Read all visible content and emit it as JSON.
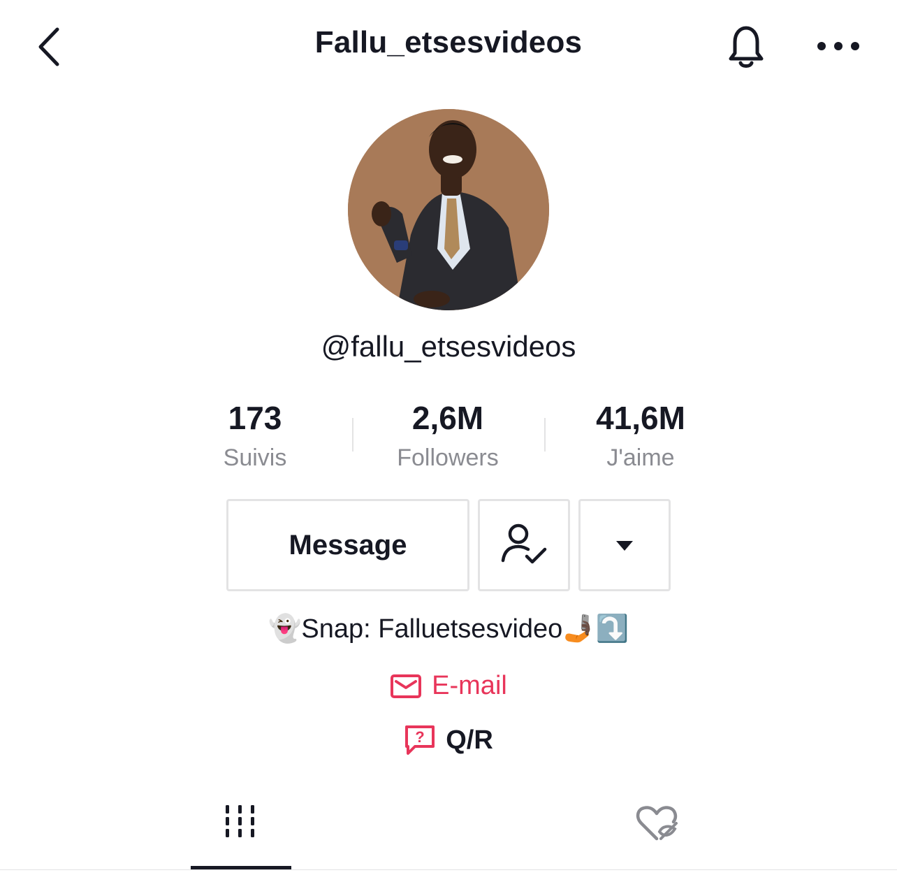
{
  "header": {
    "title": "Fallu_etsesvideos",
    "back_icon": "chevron-left-icon",
    "bell_icon": "bell-icon",
    "more_icon": "more-horizontal-icon"
  },
  "profile": {
    "handle": "@fallu_etsesvideos",
    "stats": [
      {
        "value": "173",
        "label": "Suivis"
      },
      {
        "value": "2,6M",
        "label": "Followers"
      },
      {
        "value": "41,6M",
        "label": "J'aime"
      }
    ],
    "bio": "👻Snap: Falluetsesvideo🤳🏿⤵️",
    "email_label": "E-mail",
    "qa_label": "Q/R"
  },
  "actions": {
    "message_label": "Message",
    "following_icon": "user-check-icon",
    "dropdown_icon": "caret-down-icon"
  },
  "tabs": [
    {
      "icon": "grid-icon",
      "selected": true
    },
    {
      "icon": "liked-hidden-icon",
      "selected": false
    }
  ],
  "colors": {
    "accent": "#e8355a",
    "text": "#161823",
    "muted": "#8a8b91",
    "border": "#e3e3e4"
  }
}
